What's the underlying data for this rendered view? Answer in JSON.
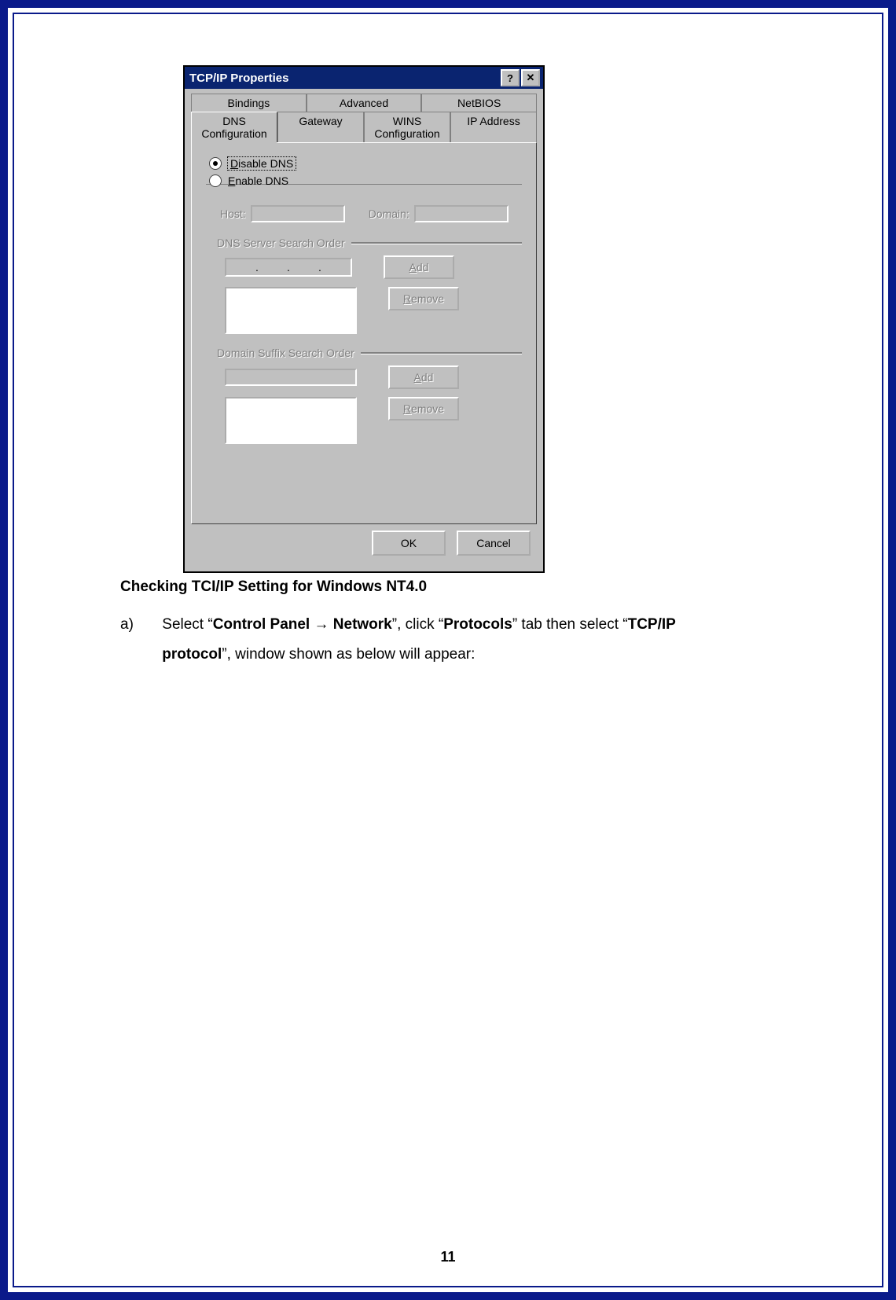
{
  "page_number": "11",
  "dialog": {
    "title": "TCP/IP Properties",
    "help_glyph": "?",
    "close_glyph": "✕",
    "tabs_row1": [
      "Bindings",
      "Advanced",
      "NetBIOS"
    ],
    "tabs_row2": [
      "DNS Configuration",
      "Gateway",
      "WINS Configuration",
      "IP Address"
    ],
    "active_tab": "DNS Configuration",
    "radio_disable": "Disable DNS",
    "radio_enable": "Enable DNS",
    "host_label": "Host:",
    "domain_label": "Domain:",
    "group1_title": "DNS Server Search Order",
    "group2_title": "Domain Suffix Search Order",
    "add_label": "Add",
    "remove_label": "Remove",
    "ok_label": "OK",
    "cancel_label": "Cancel"
  },
  "text": {
    "heading": "Checking TCI/IP Setting for Windows NT4.0",
    "item_marker": "a)",
    "p1_a": "Select “",
    "p1_b": "Control Panel",
    "p1_arrow": " → ",
    "p1_c": "Network",
    "p1_d": "”, click “",
    "p1_e": "Protocols",
    "p1_f": "” tab then select “",
    "p1_g": "TCP/IP",
    "p2_a": "protocol",
    "p2_b": "”, window shown as below will appear:"
  }
}
